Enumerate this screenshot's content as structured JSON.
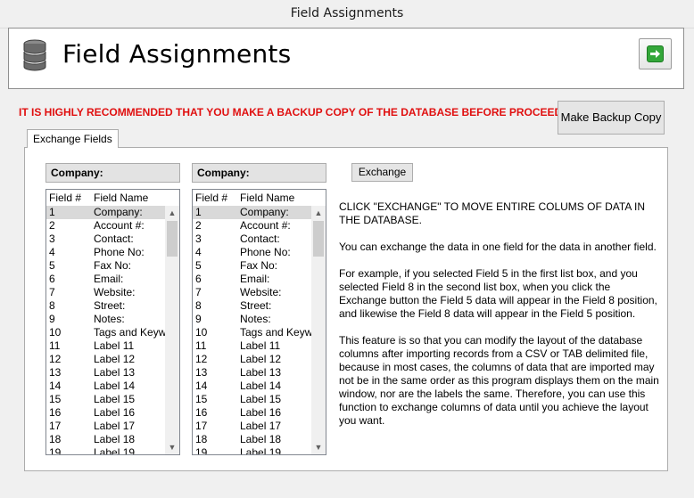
{
  "window": {
    "title": "Field Assignments"
  },
  "header": {
    "title": "Field Assignments",
    "icon": "database-icon",
    "go_icon": "green-arrow-icon"
  },
  "warning": "IT IS HIGHLY RECOMMENDED THAT YOU MAKE A BACKUP COPY OF THE DATABASE BEFORE PROCEEDING.",
  "backup_button": "Make Backup Copy",
  "tab_label": "Exchange Fields",
  "exchange_button": "Exchange",
  "left": {
    "company": "Company:",
    "col_num": "Field #",
    "col_name": "Field Name"
  },
  "right": {
    "company": "Company:",
    "col_num": "Field #",
    "col_name": "Field Name"
  },
  "fields": [
    {
      "num": "1",
      "name": "Company:"
    },
    {
      "num": "2",
      "name": "Account #:"
    },
    {
      "num": "3",
      "name": "Contact:"
    },
    {
      "num": "4",
      "name": "Phone No:"
    },
    {
      "num": "5",
      "name": "Fax No:"
    },
    {
      "num": "6",
      "name": "Email:"
    },
    {
      "num": "7",
      "name": "Website:"
    },
    {
      "num": "8",
      "name": "Street:"
    },
    {
      "num": "9",
      "name": "Notes:"
    },
    {
      "num": "10",
      "name": "Tags and Keyw"
    },
    {
      "num": "11",
      "name": "Label 11"
    },
    {
      "num": "12",
      "name": "Label 12"
    },
    {
      "num": "13",
      "name": "Label 13"
    },
    {
      "num": "14",
      "name": "Label 14"
    },
    {
      "num": "15",
      "name": "Label 15"
    },
    {
      "num": "16",
      "name": "Label 16"
    },
    {
      "num": "17",
      "name": "Label 17"
    },
    {
      "num": "18",
      "name": "Label 18"
    },
    {
      "num": "19",
      "name": "Label 19"
    }
  ],
  "info": {
    "p1": "CLICK \"EXCHANGE\" TO MOVE ENTIRE COLUMS OF DATA IN THE DATABASE.",
    "p2": "You can exchange the data in one field for the data in another field.",
    "p3": "For example, if you selected Field 5 in the first list box, and you selected Field 8 in the second list box, when you click the Exchange button the Field 5 data will appear in the Field 8 position, and likewise the Field 8 data will appear in the Field 5 position.",
    "p4": "This feature is so that you can  modify the layout of the database columns after importing records from a CSV or TAB delimited file, because in most cases, the columns of data that are imported may not be in the same order as this program displays them on the main window, nor are the labels the same.  Therefore, you can use this function to exchange columns of data until you achieve the layout you want."
  }
}
